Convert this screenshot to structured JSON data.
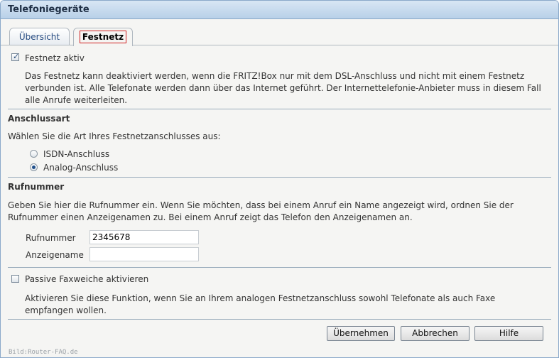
{
  "window": {
    "title": "Telefoniegeräte"
  },
  "tabs": [
    {
      "label": "Übersicht",
      "active": false
    },
    {
      "label": "Festnetz",
      "active": true
    }
  ],
  "festnetz": {
    "checkbox_label": "Festnetz aktiv",
    "checked": true,
    "description": "Das Festnetz kann deaktiviert werden, wenn die FRITZ!Box nur mit dem DSL-Anschluss und nicht mit einem Festnetz verbunden ist. Alle Telefonate werden dann über das Internet geführt. Der Internettelefonie-Anbieter muss in diesem Fall alle Anrufe weiterleiten."
  },
  "anschlussart": {
    "heading": "Anschlussart",
    "prompt": "Wählen Sie die Art Ihres Festnetzanschlusses aus:",
    "options": [
      {
        "label": "ISDN-Anschluss",
        "selected": false
      },
      {
        "label": "Analog-Anschluss",
        "selected": true
      }
    ]
  },
  "rufnummer": {
    "heading": "Rufnummer",
    "description": "Geben Sie hier die Rufnummer ein. Wenn Sie möchten, dass bei einem Anruf ein Name angezeigt wird, ordnen Sie der Rufnummer einen Anzeigenamen zu. Bei einem Anruf zeigt das Telefon den Anzeigenamen an.",
    "number_label": "Rufnummer",
    "number_value": "2345678",
    "name_label": "Anzeigename",
    "name_value": ""
  },
  "fax": {
    "checkbox_label": "Passive Faxweiche aktivieren",
    "checked": false,
    "description": "Aktivieren Sie diese Funktion, wenn Sie an Ihrem analogen Festnetzanschluss sowohl Telefonate als auch Faxe empfangen wollen."
  },
  "buttons": {
    "apply": "Übernehmen",
    "cancel": "Abbrechen",
    "help": "Hilfe"
  },
  "watermark": "Bild:Router-FAQ.de",
  "colors": {
    "titlebar": "#c8dcf0",
    "frame_border": "#8aa9c9",
    "active_tab_outline": "#d02020",
    "panel_background": "#f5f5f3"
  }
}
